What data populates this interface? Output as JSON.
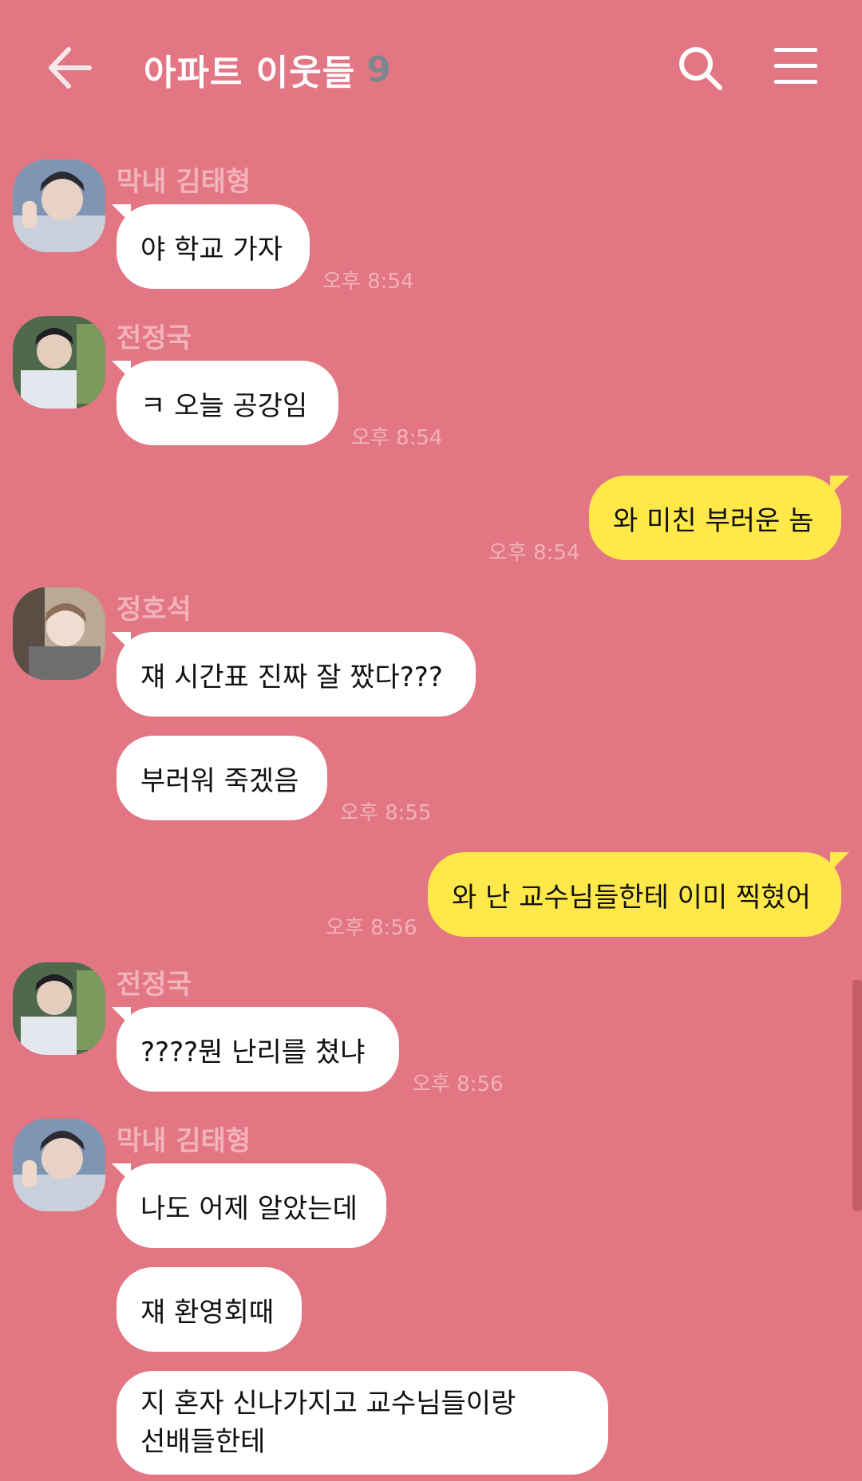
{
  "header": {
    "title": "아파트 이웃들",
    "member_count": "9"
  },
  "messages": [
    {
      "sender": "막내 김태형",
      "text": "야 학교 가자",
      "time": "오후 8:54"
    },
    {
      "sender": "전정국",
      "text": "ㅋ 오늘 공강임",
      "time": "오후 8:54"
    },
    {
      "sender": "me",
      "text": "와 미친 부러운 놈",
      "time": "오후 8:54"
    },
    {
      "sender": "정호석",
      "text": "쟤 시간표 진짜 잘 짰다???"
    },
    {
      "sender": "정호석",
      "text": "부러워 죽겠음",
      "time": "오후 8:55"
    },
    {
      "sender": "me",
      "text": "와 난 교수님들한테 이미 찍혔어",
      "time": "오후 8:56"
    },
    {
      "sender": "전정국",
      "text": "????뭔 난리를 쳤냐",
      "time": "오후 8:56"
    },
    {
      "sender": "막내 김태형",
      "text": "나도 어제 알았는데"
    },
    {
      "sender": "막내 김태형",
      "text": "쟤 환영회때"
    },
    {
      "sender": "막내 김태형",
      "text_line1": "지 혼자 신나가지고 교수님들이랑",
      "text_line2": "선배들한테"
    }
  ],
  "colors": {
    "background": "#E27682",
    "my_bubble": "#FFE94A",
    "other_bubble": "#FFFFFF",
    "sender_name": "#F3B3BB",
    "timestamp": "#F1B2BA"
  }
}
